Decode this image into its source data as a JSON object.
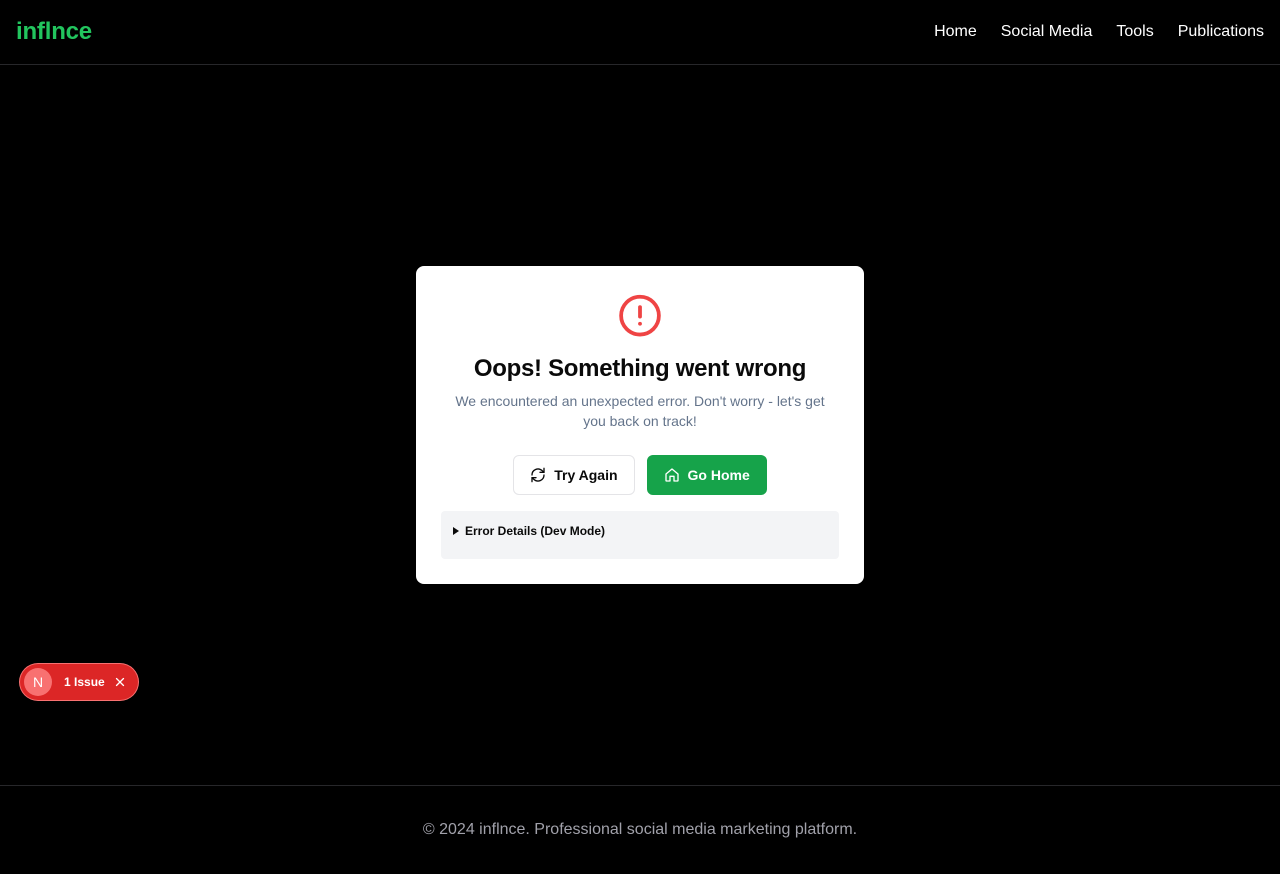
{
  "header": {
    "logo": "inflnce",
    "nav": [
      {
        "label": "Home"
      },
      {
        "label": "Social Media"
      },
      {
        "label": "Tools"
      },
      {
        "label": "Publications"
      }
    ]
  },
  "error_card": {
    "icon": "alert-circle-icon",
    "title": "Oops! Something went wrong",
    "description": "We encountered an unexpected error. Don't worry - let's get you back on track!",
    "try_again_label": "Try Again",
    "go_home_label": "Go Home",
    "details_label": "Error Details (Dev Mode)"
  },
  "dev_indicator": {
    "badge_letter": "N",
    "issue_label": "1 Issue"
  },
  "footer": {
    "text": "© 2024 inflnce. Professional social media marketing platform."
  },
  "colors": {
    "brand": "#22c55e",
    "primary_button": "#16a34a",
    "error_icon": "#ef4444",
    "issue_pill": "#dc2626"
  }
}
